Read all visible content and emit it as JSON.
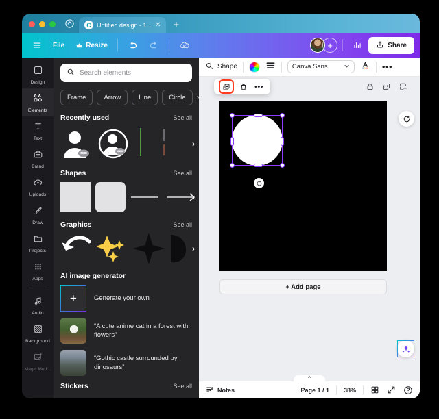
{
  "browser": {
    "home_icon": "home-icon",
    "new_tab_icon": "plus-icon",
    "tab": {
      "favicon": "canva-favicon",
      "title": "Untitled design - 1...",
      "close_icon": "close-icon"
    }
  },
  "header": {
    "menu_icon": "hamburger-menu-icon",
    "file_label": "File",
    "resize_label": "Resize",
    "resize_icon": "crown-icon",
    "undo_icon": "undo-icon",
    "redo_icon": "redo-icon",
    "cloud_icon": "cloud-saved-icon",
    "avatar": "user-avatar",
    "add_collaborator_icon": "plus-icon",
    "insights_icon": "bar-chart-icon",
    "share_label": "Share",
    "share_icon": "share-upload-icon"
  },
  "rail": {
    "items": [
      {
        "label": "Design",
        "icon": "design-icon"
      },
      {
        "label": "Elements",
        "icon": "elements-icon"
      },
      {
        "label": "Text",
        "icon": "text-icon"
      },
      {
        "label": "Brand",
        "icon": "brand-icon"
      },
      {
        "label": "Uploads",
        "icon": "uploads-icon"
      },
      {
        "label": "Draw",
        "icon": "draw-icon"
      },
      {
        "label": "Projects",
        "icon": "projects-icon"
      },
      {
        "label": "Apps",
        "icon": "apps-icon"
      },
      {
        "label": "Audio",
        "icon": "audio-icon"
      },
      {
        "label": "Background",
        "icon": "background-icon"
      },
      {
        "label": "Magic Med...",
        "icon": "magic-media-icon"
      }
    ],
    "active": "Elements"
  },
  "panel": {
    "search_placeholder": "Search elements",
    "search_icon": "search-icon",
    "chips": [
      "Frame",
      "Arrow",
      "Line",
      "Circle"
    ],
    "chip_next_icon": "chevron-right-icon",
    "see_all_label": "See all",
    "sections": [
      {
        "title": "Recently used"
      },
      {
        "title": "Shapes"
      },
      {
        "title": "Graphics"
      },
      {
        "title": "Stickers"
      }
    ],
    "ai": {
      "title": "AI image generator",
      "generate_label": "Generate your own",
      "generate_icon": "plus-icon",
      "prompts": [
        "“A cute anime cat in a forest with flowers”",
        "“Gothic castle surrounded by dinosaurs”"
      ]
    },
    "collapse_icon": "chevron-left-icon"
  },
  "toolbar": {
    "shape_label": "Shape",
    "shape_icon": "shape-icon",
    "color_icon": "color-wheel-icon",
    "lines_icon": "lines-icon",
    "font_value": "Canva Sans",
    "font_chevron_icon": "chevron-down-icon",
    "text_color_icon": "text-color-A-icon",
    "more_icon": "more-options-icon"
  },
  "floating_toolbar": {
    "duplicate_icon": "duplicate-icon",
    "delete_icon": "trash-icon",
    "more_icon": "more-options-icon",
    "highlighted": "duplicate-icon"
  },
  "page_icons": {
    "lock_icon": "lock-icon",
    "duplicate_page_icon": "duplicate-page-icon",
    "add_page_icon": "add-page-icon"
  },
  "canvas": {
    "add_page_label": "+ Add page",
    "rotate_icon": "rotate-icon",
    "refresh_icon": "refresh-icon",
    "ai_assistant_icon": "magic-sparkle-icon",
    "selected_shape": "circle"
  },
  "bottombar": {
    "notes_label": "Notes",
    "notes_icon": "notes-icon",
    "page_indicator": "Page 1 / 1",
    "zoom_level": "38%",
    "grid_icon": "grid-view-icon",
    "fullscreen_icon": "expand-icon",
    "help_icon": "help-icon",
    "collapse_chevron_icon": "chevron-up-icon"
  },
  "colors": {
    "brand_teal": "#00c4cc",
    "brand_purple": "#7d2ae8",
    "selection_purple": "#8b3dff",
    "highlight_red": "#ff3b1f",
    "panel_bg": "#252527",
    "rail_bg": "#1b1b1f"
  }
}
